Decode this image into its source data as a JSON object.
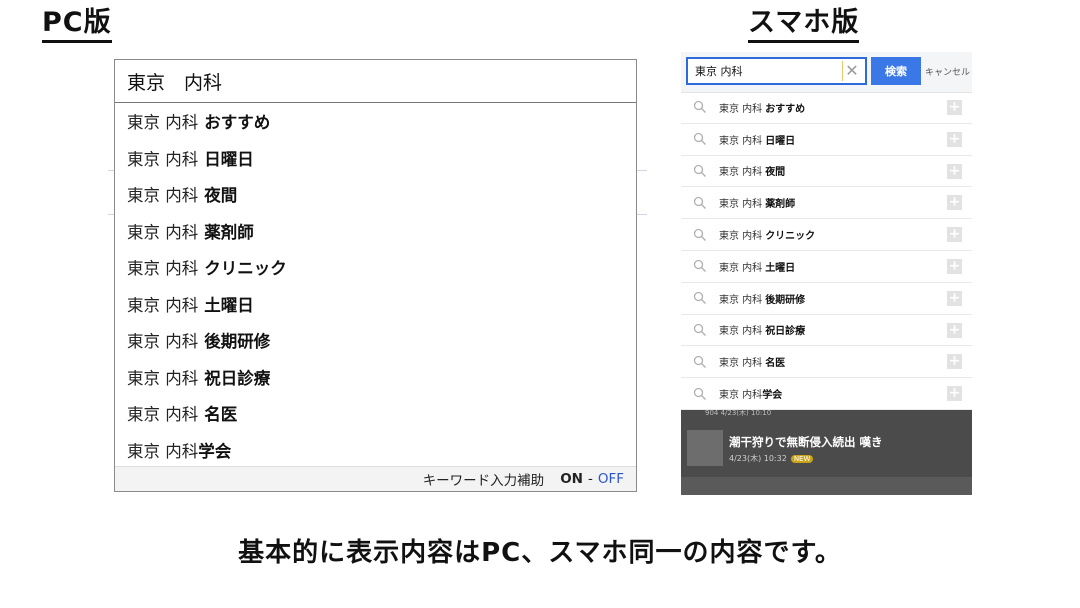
{
  "headings": {
    "pc": "PC版",
    "smartphone": "スマホ版"
  },
  "pc": {
    "query": "東京　内科",
    "base": "東京 内科",
    "suggestions": [
      {
        "base": "東京 内科",
        "suffix": "おすすめ"
      },
      {
        "base": "東京 内科",
        "suffix": "日曜日"
      },
      {
        "base": "東京 内科",
        "suffix": "夜間"
      },
      {
        "base": "東京 内科",
        "suffix": "薬剤師"
      },
      {
        "base": "東京 内科",
        "suffix": "クリニック"
      },
      {
        "base": "東京 内科",
        "suffix": "土曜日"
      },
      {
        "base": "東京 内科",
        "suffix": "後期研修"
      },
      {
        "base": "東京 内科",
        "suffix": "祝日診療"
      },
      {
        "base": "東京 内科",
        "suffix": "名医"
      },
      {
        "base": "東京 内科",
        "suffix": "学会"
      }
    ],
    "footer": {
      "label": "キーワード入力補助",
      "on": "ON",
      "dash": "-",
      "off": "OFF"
    }
  },
  "smartphone": {
    "query": "東京 内科",
    "clear": "✕",
    "search_button": "検索",
    "cancel": "キャンセル",
    "suggestions": [
      {
        "base": "東京 内科",
        "suffix": "おすすめ"
      },
      {
        "base": "東京 内科",
        "suffix": "日曜日"
      },
      {
        "base": "東京 内科",
        "suffix": "夜間"
      },
      {
        "base": "東京 内科",
        "suffix": "薬剤師"
      },
      {
        "base": "東京 内科",
        "suffix": "クリニック"
      },
      {
        "base": "東京 内科",
        "suffix": "土曜日"
      },
      {
        "base": "東京 内科",
        "suffix": "後期研修"
      },
      {
        "base": "東京 内科",
        "suffix": "祝日診療"
      },
      {
        "base": "東京 内科",
        "suffix": "名医"
      },
      {
        "base": "東京 内科",
        "suffix": "学会"
      }
    ],
    "plus": "+",
    "news": {
      "title": "潮干狩りで無断侵入続出 嘆き",
      "meta": "4/23(木) 10:32",
      "badge": "NEW",
      "prev_meta": "904 4/23(木) 10:10"
    }
  },
  "caption": "基本的に表示内容はPC、スマホ同一の内容です。"
}
